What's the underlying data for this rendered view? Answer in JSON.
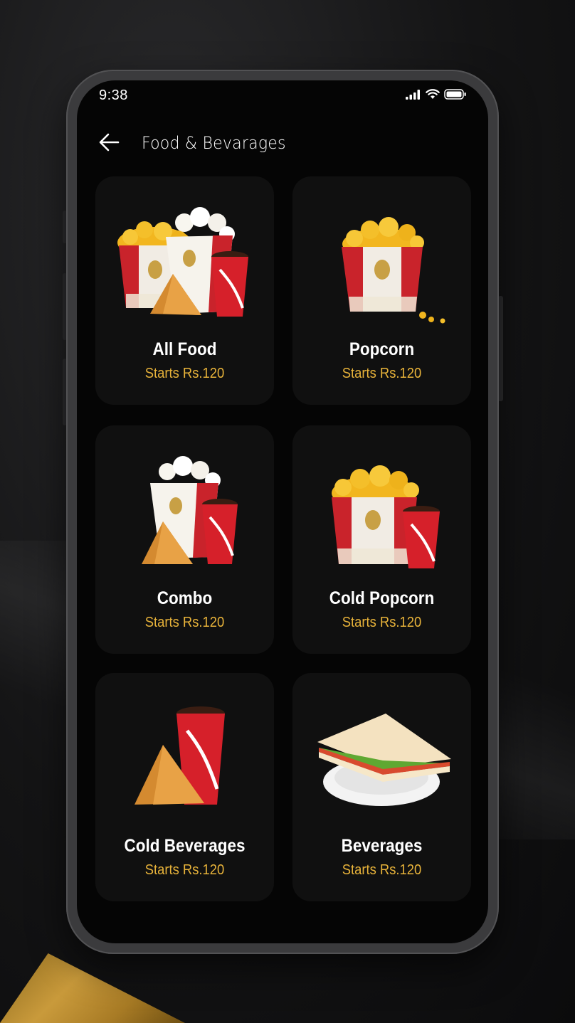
{
  "status_bar": {
    "time": "9:38"
  },
  "header": {
    "title": "Food & Bevarages"
  },
  "categories": [
    {
      "name": "All Food",
      "price": "Starts Rs.120",
      "image": "popcorn-samosa-cola-image"
    },
    {
      "name": "Popcorn",
      "price": "Starts Rs.120",
      "image": "popcorn-tub-image"
    },
    {
      "name": "Combo",
      "price": "Starts Rs.120",
      "image": "popcorn-box-samosa-cola-image"
    },
    {
      "name": "Cold Popcorn",
      "price": "Starts Rs.120",
      "image": "popcorn-tub-cola-image"
    },
    {
      "name": "Cold Beverages",
      "price": "Starts Rs.120",
      "image": "samosa-cola-image"
    },
    {
      "name": "Beverages",
      "price": "Starts Rs.120",
      "image": "sandwich-plate-image"
    }
  ],
  "colors": {
    "accent": "#e8b33a",
    "card": "#101010",
    "screen": "#050505"
  }
}
